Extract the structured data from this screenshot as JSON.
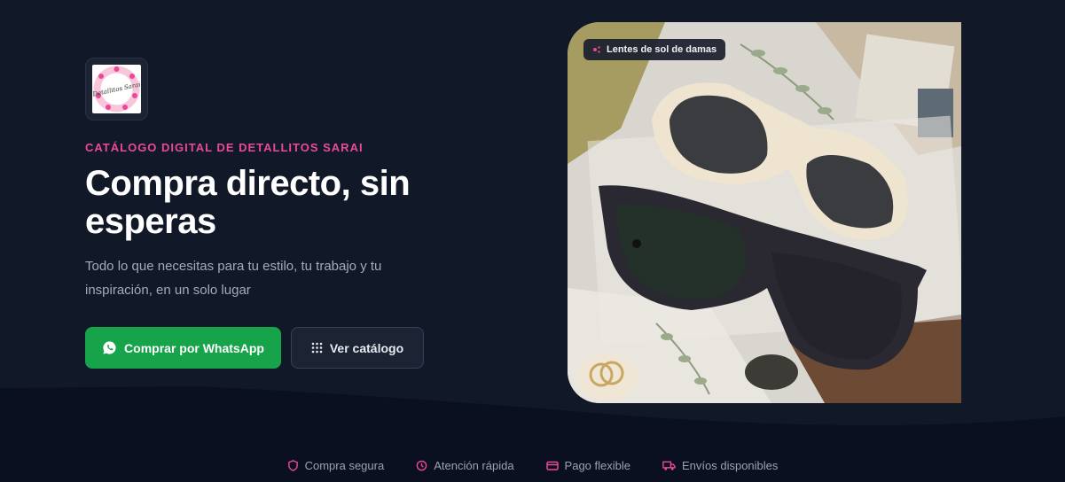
{
  "brand": {
    "logo_text": "Detallitos Sarai",
    "eyebrow": "CATÁLOGO DIGITAL DE DETALLITOS SARAI"
  },
  "hero": {
    "title": "Compra directo, sin esperas",
    "subtitle": "Todo lo que necesitas para tu estilo, tu trabajo y tu inspiración, en un solo lugar"
  },
  "buttons": {
    "whatsapp_label": "Comprar por WhatsApp",
    "catalog_label": "Ver catálogo",
    "whatsapp_color": "#16a34a"
  },
  "photo": {
    "badge_label": "Lentes de sol de damas"
  },
  "features": [
    {
      "label": "Compra segura",
      "icon": "shield-icon"
    },
    {
      "label": "Atención rápida",
      "icon": "clock-icon"
    },
    {
      "label": "Pago flexible",
      "icon": "credit-card-icon"
    },
    {
      "label": "Envíos disponibles",
      "icon": "truck-icon"
    }
  ],
  "colors": {
    "accent": "#ec4899",
    "background": "#111827",
    "background_dark": "#0b1020"
  }
}
